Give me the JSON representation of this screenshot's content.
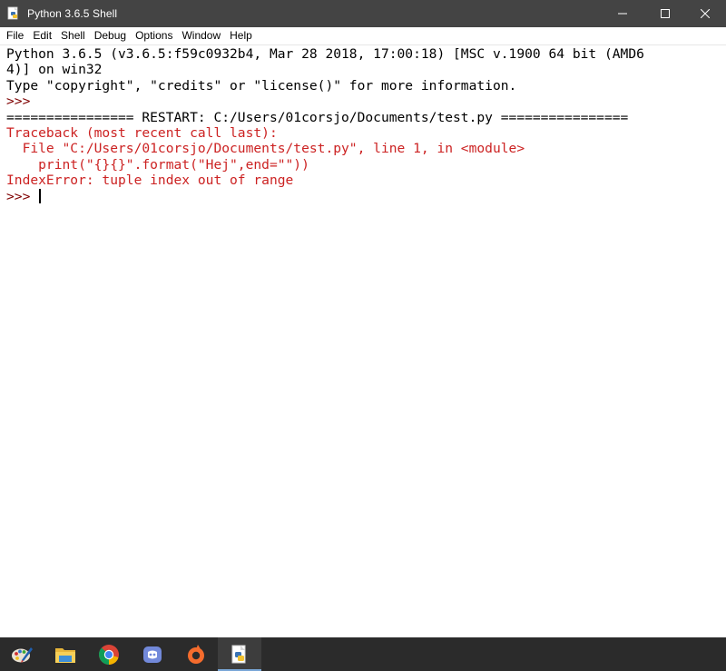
{
  "window": {
    "title": "Python 3.6.5 Shell",
    "controls": {
      "minimize_glyph": "–",
      "maximize_glyph": "☐",
      "close_glyph": "✕"
    }
  },
  "menu": {
    "items": [
      "File",
      "Edit",
      "Shell",
      "Debug",
      "Options",
      "Window",
      "Help"
    ]
  },
  "console": {
    "lines": [
      {
        "kind": "stdout",
        "text": "Python 3.6.5 (v3.6.5:f59c0932b4, Mar 28 2018, 17:00:18) [MSC v.1900 64 bit (AMD6"
      },
      {
        "kind": "stdout",
        "text": "4)] on win32"
      },
      {
        "kind": "stdout",
        "text": "Type \"copyright\", \"credits\" or \"license()\" for more information."
      },
      {
        "kind": "prompt",
        "text": ">>> "
      },
      {
        "kind": "restart",
        "text": "================ RESTART: C:/Users/01corsjo/Documents/test.py ================"
      },
      {
        "kind": "stderr",
        "text": "Traceback (most recent call last):"
      },
      {
        "kind": "stderr",
        "text": "  File \"C:/Users/01corsjo/Documents/test.py\", line 1, in <module>"
      },
      {
        "kind": "stderr",
        "text": "    print(\"{}{}\".format(\"Hej\",end=\"\"))"
      },
      {
        "kind": "stderr",
        "text": "IndexError: tuple index out of range"
      }
    ],
    "active_prompt": ">>> "
  },
  "taskbar": {
    "apps": [
      {
        "icon": "paint-icon"
      },
      {
        "icon": "file-explorer-icon"
      },
      {
        "icon": "chrome-icon"
      },
      {
        "icon": "discord-icon"
      },
      {
        "icon": "origin-icon"
      },
      {
        "icon": "python-idle-icon",
        "active": true
      }
    ]
  },
  "colors": {
    "titlebar": "#444444",
    "stderr": "#cc2222",
    "prompt": "#7f0000",
    "taskbar": "#2b2b2b"
  }
}
